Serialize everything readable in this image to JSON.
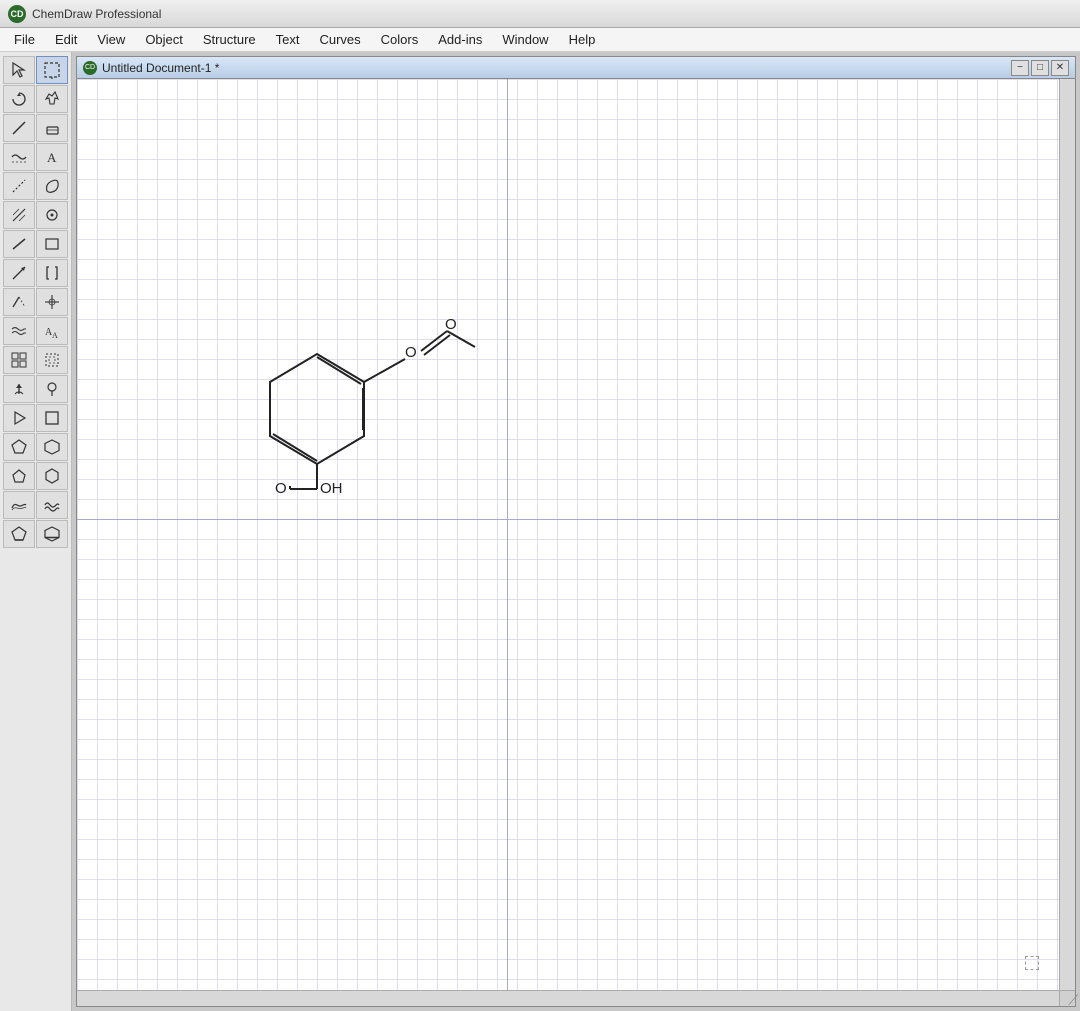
{
  "app": {
    "title": "ChemDraw Professional",
    "icon_label": "CD"
  },
  "menu": {
    "items": [
      "File",
      "Edit",
      "View",
      "Object",
      "Structure",
      "Text",
      "Curves",
      "Colors",
      "Add-ins",
      "Window",
      "Help"
    ]
  },
  "document": {
    "title": "Untitled Document-1 *",
    "icon_label": "CD"
  },
  "doc_window_buttons": {
    "minimize": "−",
    "restore": "□",
    "close": "✕"
  },
  "toolbar": {
    "tools": [
      {
        "name": "select-arrow",
        "symbol": "↖"
      },
      {
        "name": "lasso-select",
        "symbol": "⬚"
      },
      {
        "name": "rotate",
        "symbol": "↻"
      },
      {
        "name": "marquee",
        "symbol": "⌕"
      },
      {
        "name": "line",
        "symbol": "/"
      },
      {
        "name": "eraser",
        "symbol": "⌫"
      },
      {
        "name": "bond-wavy",
        "symbol": "~"
      },
      {
        "name": "text",
        "symbol": "A"
      },
      {
        "name": "dashed-line",
        "symbol": "⋯"
      },
      {
        "name": "lasso",
        "symbol": "∿"
      },
      {
        "name": "hatch",
        "symbol": "▨"
      },
      {
        "name": "atom-map",
        "symbol": "⚛"
      },
      {
        "name": "bond-tool",
        "symbol": "/"
      },
      {
        "name": "rect-select",
        "symbol": "▭"
      },
      {
        "name": "arrow-tool",
        "symbol": "↗"
      },
      {
        "name": "bracket",
        "symbol": "⌐"
      },
      {
        "name": "angle-bond",
        "symbol": "∠"
      },
      {
        "name": "crosshair",
        "symbol": "+"
      },
      {
        "name": "wavy-bond",
        "symbol": "≈"
      },
      {
        "name": "scale-text",
        "symbol": "A↕"
      },
      {
        "name": "grid-tool",
        "symbol": "⊞"
      },
      {
        "name": "dotted-rect",
        "symbol": "⊡"
      },
      {
        "name": "arrow-up",
        "symbol": "⬆"
      },
      {
        "name": "pin",
        "symbol": "📌"
      },
      {
        "name": "play",
        "symbol": "▷"
      },
      {
        "name": "square",
        "symbol": "□"
      },
      {
        "name": "pentagon",
        "symbol": "⬠"
      },
      {
        "name": "hexagon",
        "symbol": "⬡"
      },
      {
        "name": "small-pentagon",
        "symbol": "⬟"
      },
      {
        "name": "small-hexagon",
        "symbol": "⬢"
      },
      {
        "name": "wave1",
        "symbol": "〜"
      },
      {
        "name": "wave2",
        "symbol": "≋"
      },
      {
        "name": "triangle-pent",
        "symbol": "△"
      },
      {
        "name": "triangle-hex",
        "symbol": "▽"
      }
    ]
  }
}
